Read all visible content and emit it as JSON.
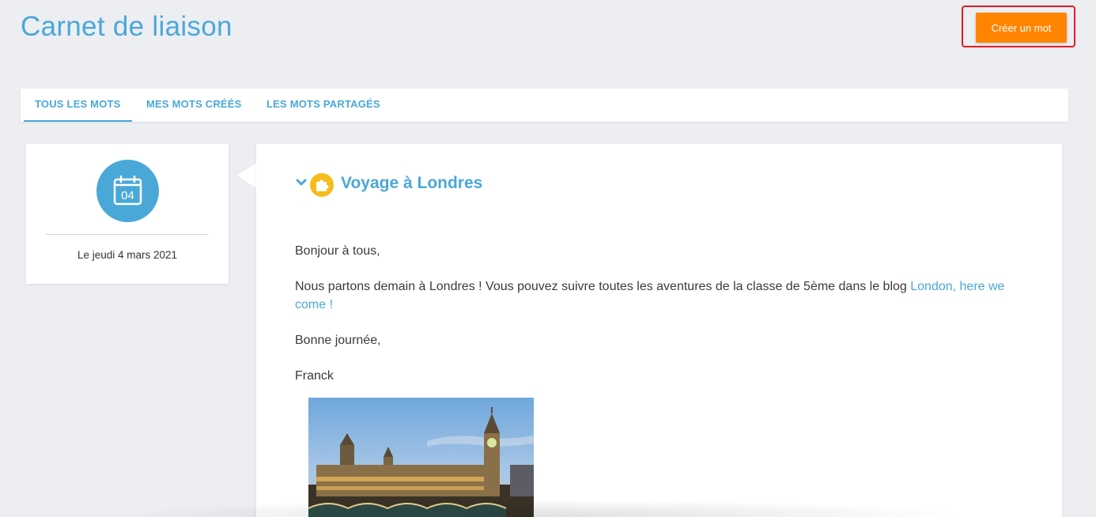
{
  "header": {
    "title": "Carnet de liaison",
    "create_button_label": "Créer un mot"
  },
  "tabs": [
    {
      "label": "TOUS LES MOTS",
      "active": true
    },
    {
      "label": "MES MOTS CRÉÉS",
      "active": false
    },
    {
      "label": "LES MOTS PARTAGÉS",
      "active": false
    }
  ],
  "date_card": {
    "calendar_day": "04",
    "date_text": "Le jeudi 4 mars 2021"
  },
  "message": {
    "title": "Voyage à Londres",
    "greeting": "Bonjour à tous,",
    "body_text": "Nous partons demain à Londres ! Vous pouvez suivre toutes les aventures de la classe de 5ème dans le blog ",
    "blog_link_text": "London, here we come !",
    "closing": "Bonne journée,",
    "signature": "Franck"
  },
  "colors": {
    "accent": "#4aa8d8",
    "create_button": "#ff8500",
    "highlight_border": "#e01b24",
    "category_badge": "#f6bc1c"
  },
  "icons": {
    "calendar": "calendar-icon",
    "chevron": "chevron-down-icon",
    "category": "puzzle-icon"
  }
}
